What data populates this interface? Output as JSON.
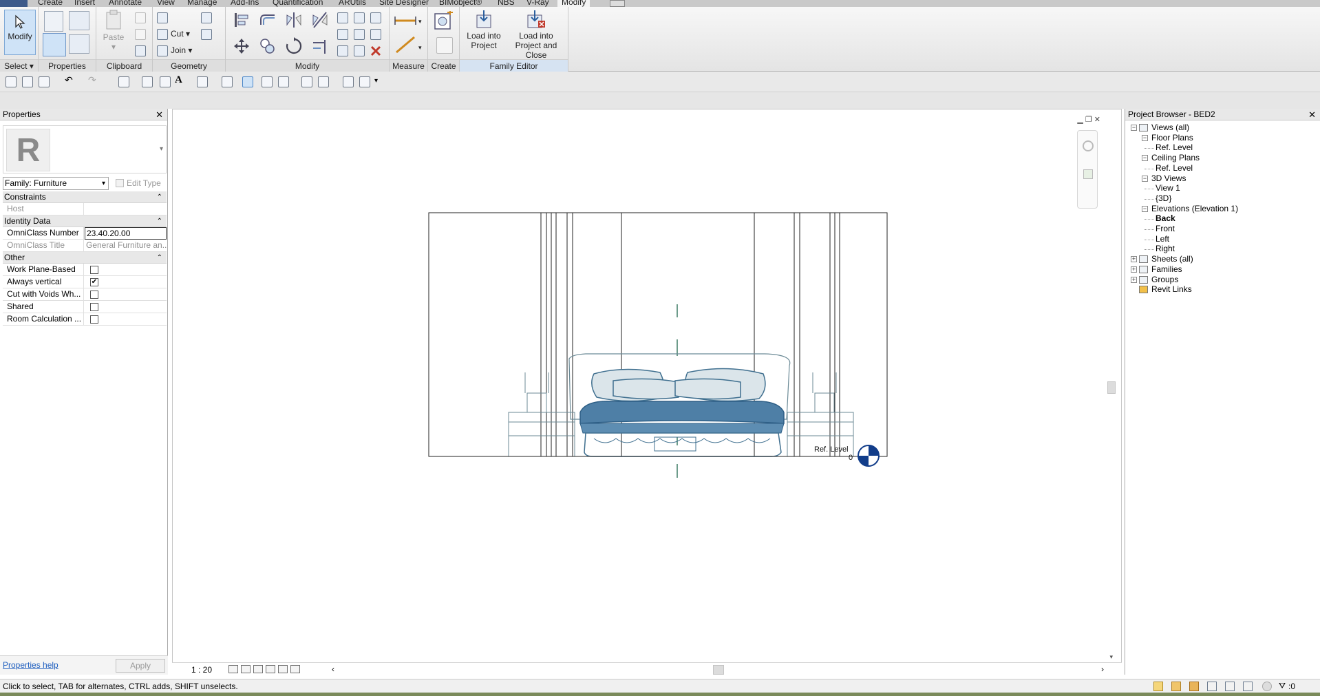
{
  "ribbon_tabs": [
    "Create",
    "Insert",
    "Annotate",
    "View",
    "Manage",
    "Add-Ins",
    "Quantification",
    "ARUtils",
    "Site Designer",
    "BIMobject®",
    "NBS",
    "V-Ray",
    "Modify"
  ],
  "ribbon": {
    "select": {
      "button": "Modify",
      "label": "Select"
    },
    "properties_label": "Properties",
    "clipboard": {
      "paste": "Paste",
      "label": "Clipboard"
    },
    "geometry": {
      "cut": "Cut",
      "join": "Join",
      "label": "Geometry"
    },
    "modify_label": "Modify",
    "measure_label": "Measure",
    "create_label": "Create",
    "family_editor": {
      "load_into_project": [
        "Load into",
        "Project"
      ],
      "load_into_project_close": [
        "Load into",
        "Project and Close"
      ],
      "label": "Family Editor"
    }
  },
  "properties": {
    "title": "Properties",
    "family_selector": "Family: Furniture",
    "edit_type": "Edit Type",
    "groups": [
      {
        "name": "Constraints",
        "rows": [
          {
            "name": "Host",
            "value": "",
            "kind": "text",
            "disabled": true
          }
        ]
      },
      {
        "name": "Identity Data",
        "rows": [
          {
            "name": "OmniClass Number",
            "value": "23.40.20.00",
            "kind": "input",
            "disabled": false
          },
          {
            "name": "OmniClass Title",
            "value": "General Furniture an...",
            "kind": "text",
            "disabled": true
          }
        ]
      },
      {
        "name": "Other",
        "rows": [
          {
            "name": "Work Plane-Based",
            "checked": false,
            "kind": "check"
          },
          {
            "name": "Always vertical",
            "checked": true,
            "kind": "check"
          },
          {
            "name": "Cut with Voids Wh...",
            "checked": false,
            "kind": "check"
          },
          {
            "name": "Shared",
            "checked": false,
            "kind": "check"
          },
          {
            "name": "Room Calculation ...",
            "checked": false,
            "kind": "check"
          }
        ]
      }
    ],
    "help_link": "Properties help",
    "apply": "Apply"
  },
  "view": {
    "level_label": "Ref. Level",
    "level_elevation": "0",
    "scale": "1 : 20"
  },
  "project_browser": {
    "title": "Project Browser - BED2",
    "items": [
      {
        "label": "Views (all)",
        "indent": 0,
        "bold": false
      },
      {
        "label": "Floor Plans",
        "indent": 1,
        "bold": false
      },
      {
        "label": "Ref. Level",
        "indent": 2,
        "bold": false
      },
      {
        "label": "Ceiling Plans",
        "indent": 1,
        "bold": false
      },
      {
        "label": "Ref. Level",
        "indent": 2,
        "bold": false
      },
      {
        "label": "3D Views",
        "indent": 1,
        "bold": false
      },
      {
        "label": "View 1",
        "indent": 2,
        "bold": false
      },
      {
        "label": "{3D}",
        "indent": 2,
        "bold": false
      },
      {
        "label": "Elevations (Elevation 1)",
        "indent": 1,
        "bold": false
      },
      {
        "label": "Back",
        "indent": 2,
        "bold": true
      },
      {
        "label": "Front",
        "indent": 2,
        "bold": false
      },
      {
        "label": "Left",
        "indent": 2,
        "bold": false
      },
      {
        "label": "Right",
        "indent": 2,
        "bold": false
      },
      {
        "label": "Sheets (all)",
        "indent": 0,
        "bold": false
      },
      {
        "label": "Families",
        "indent": 0,
        "bold": false
      },
      {
        "label": "Groups",
        "indent": 0,
        "bold": false
      },
      {
        "label": "Revit Links",
        "indent": 0,
        "bold": false
      }
    ]
  },
  "status_bar": {
    "message": "Click to select, TAB for alternates, CTRL adds, SHIFT unselects.",
    "filter_count": ":0"
  }
}
